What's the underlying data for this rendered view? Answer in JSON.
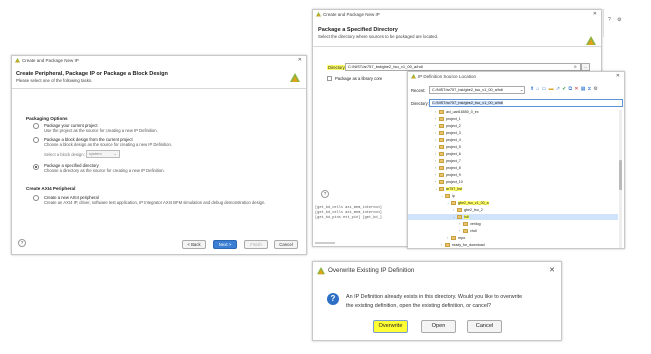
{
  "win1": {
    "title": "Create and Package New IP",
    "header": "Create Peripheral, Package IP or Package a Block Design",
    "subheader": "Please select one of the following tasks.",
    "packaging_heading": "Packaging Options",
    "options": [
      {
        "line1": "Package your current project",
        "line2": "Use the project as the source for creating a new IP Definition."
      },
      {
        "line1": "Package a block design from the current project",
        "line2": "Choose a block design as the source for creating a new IP Definition."
      },
      {
        "line1": "Package a specified directory",
        "line2": "Choose a directory as the source for creating a new IP Definition."
      }
    ],
    "select_bd_label": "Select a block design:",
    "select_bd_value": "system",
    "axi_heading": "Create AXI4 Peripheral",
    "axi_line1": "Create a new AXI4 peripheral",
    "axi_line2": "Create an AXI4 IP, driver, software test application, IP Integrator AXI4 BFM simulation and debug demonstration design.",
    "back": "< Back",
    "next": "Next >",
    "finish": "Finish",
    "cancel": "Cancel"
  },
  "win2": {
    "title": "Create and Package New IP",
    "header": "Package a Specified Directory",
    "subheader": "Select the directory where sources to be packaged are located.",
    "dir_label": "Directory:",
    "dir_value": "C:/NIST/ar757_bst/gbe2_tsu_v1_00_a/hdl",
    "library_core": "Package as a library core",
    "tcl_lines": [
      "[get_bd_cells axi_mem_intercon]",
      "[get_bd_cells axi_mem_intercon]",
      "[get_bd_pins ext_pin] [get_bd_]"
    ]
  },
  "win3": {
    "title": "IP Definition Source Location",
    "recent_label": "Recent:",
    "recent_value": "C:/NIST/ar757_bst/gbe2_tsu_v1_00_a/hdl",
    "directory_label": "Directory:",
    "directory_value": "C:/NIST/ar757_bst/gbe2_tsu_v1_00_a/hdl",
    "tree": [
      {
        "label": "axi_uart16550_0_ex",
        "indent": 0
      },
      {
        "label": "project_1",
        "indent": 0
      },
      {
        "label": "project_2",
        "indent": 0
      },
      {
        "label": "project_3",
        "indent": 0
      },
      {
        "label": "project_4",
        "indent": 0
      },
      {
        "label": "project_5",
        "indent": 0
      },
      {
        "label": "project_6",
        "indent": 0
      },
      {
        "label": "project_7",
        "indent": 0
      },
      {
        "label": "project_8",
        "indent": 0
      },
      {
        "label": "project_9",
        "indent": 0
      },
      {
        "label": "project_10",
        "indent": 0
      },
      {
        "label": "ar757_bst",
        "indent": 0
      },
      {
        "label": "ip",
        "indent": 1
      },
      {
        "label": "gbe2_tsu_v1_00_a",
        "indent": 2
      },
      {
        "label": "gbe2_tsu_2",
        "indent": 3
      },
      {
        "label": "hdl",
        "indent": 3
      },
      {
        "label": "verilog",
        "indent": 4
      },
      {
        "label": "vhdl",
        "indent": 4
      },
      {
        "label": "repo",
        "indent": 2
      },
      {
        "label": "ready_for_download",
        "indent": 1
      }
    ]
  },
  "win4": {
    "title": "Overwrite Existing IP Definition",
    "message_line1": "An IP Definition already exists in this directory. Would you like to overwrite",
    "message_line2": "the existing definition, open the existing definition, or cancel?",
    "overwrite": "Overwrite",
    "open": "Open",
    "cancel": "Cancel"
  },
  "colors": {
    "highlight": "#ffff66",
    "accent": "#3b7fd4",
    "selection": "#cfe3fb"
  }
}
